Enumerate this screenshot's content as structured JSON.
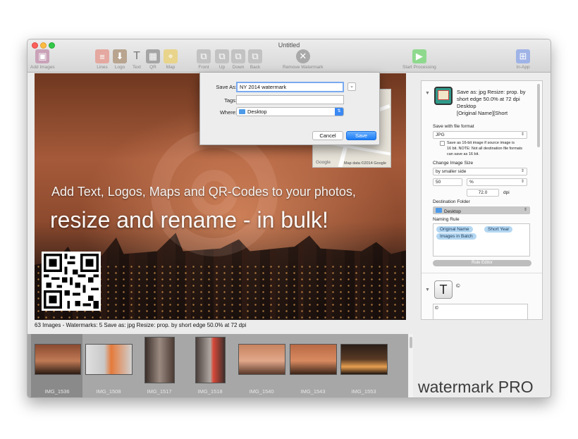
{
  "window": {
    "title": "Untitled"
  },
  "toolbar": {
    "add_images": "Add Images",
    "lines": "Lines",
    "logo": "Logo",
    "text": "Text",
    "qr": "QR",
    "map": "Map",
    "front": "Front",
    "up": "Up",
    "down": "Down",
    "back": "Back",
    "remove_watermark": "Remove Watermark",
    "start_processing": "Start Processing",
    "in_app": "In-App"
  },
  "canvas": {
    "headline1": "Add Text, Logos, Maps and QR-Codes to your photos,",
    "headline2": "resize and rename - in bulk!",
    "map_attribution": "Map data ©2014 Google",
    "map_logo": "Google"
  },
  "save_dialog": {
    "save_as_label": "Save As:",
    "save_as_value": "NY 2014 watermark",
    "tags_label": "Tags:",
    "tags_value": "",
    "where_label": "Where:",
    "where_value": "Desktop",
    "cancel": "Cancel",
    "save": "Save"
  },
  "status_bar": "63 Images   -  Watermarks: 5  Save as: jpg  Resize: prop. by short edge 50.0% at 72 dpi",
  "filmstrip": [
    {
      "name": "IMG_1536",
      "selected": true
    },
    {
      "name": "IMG_1508",
      "selected": false
    },
    {
      "name": "IMG_1517",
      "selected": false
    },
    {
      "name": "IMG_1518",
      "selected": false
    },
    {
      "name": "IMG_1540",
      "selected": false
    },
    {
      "name": "IMG_1543",
      "selected": false
    },
    {
      "name": "IMG_1553",
      "selected": false
    }
  ],
  "brand": "watermark PRO",
  "panel": {
    "summary_line1": "Save as: jpg  Resize: prop. by",
    "summary_line2": "short edge 50.0% at 72 dpi",
    "summary_line3": "Desktop",
    "summary_line4": "[Original Name][Short",
    "save_format_label": "Save with file format",
    "save_format_value": "JPG",
    "sixteen_bit_line1": "Save as 16-bit image if source image is",
    "sixteen_bit_line2": "16 bit. NOTE: Not all destination file formats",
    "sixteen_bit_line3": "can save as 16 bit.",
    "change_size_label": "Change Image Size",
    "size_mode": "by smaller side",
    "size_value": "50",
    "size_unit": "%",
    "dpi_value": "72.0",
    "dpi_label": "dpi",
    "dest_label": "Destination Folder",
    "dest_value": "Desktop",
    "naming_label": "Naming Rule",
    "naming_chips": [
      "Original Name",
      "Short Year",
      "Images in Batch"
    ],
    "rule_editor": "Rule Editor",
    "text_symbol": "©",
    "text_field_value": "©"
  }
}
